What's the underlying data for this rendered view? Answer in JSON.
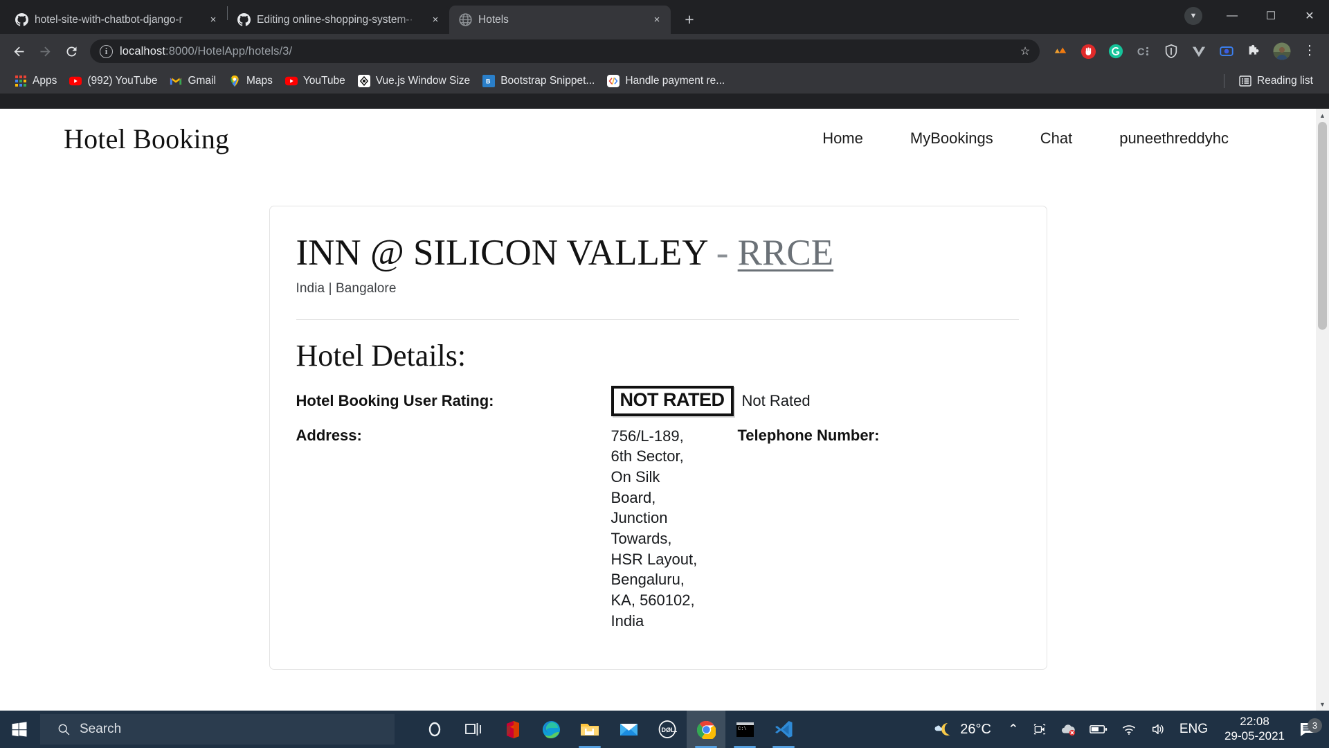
{
  "browser": {
    "tabs": [
      {
        "title": "hotel-site-with-chatbot-django-r",
        "icon": "github-icon",
        "active": false,
        "close_label": "×"
      },
      {
        "title": "Editing online-shopping-system-·",
        "icon": "github-icon",
        "active": false,
        "close_label": "×"
      },
      {
        "title": "Hotels",
        "icon": "globe-icon",
        "active": true,
        "close_label": "×"
      }
    ],
    "new_tab_label": "+",
    "window_controls": {
      "minimize": "—",
      "maximize": "☐",
      "close": "✕",
      "profile_chevron": "▼"
    },
    "nav": {
      "back": "←",
      "forward": "→",
      "reload": "↻"
    },
    "omnibox": {
      "url_host": "localhost",
      "url_path": ":8000/HotelApp/hotels/3/",
      "info_icon": "i",
      "star_icon": "☆"
    },
    "extensions": [
      "triangles-icon",
      "adblock-hand-icon",
      "grammarly-icon",
      "colorzilla-icon",
      "shield-icon",
      "vue-devtools-icon",
      "loom-icon",
      "puzzle-piece-icon",
      "profile-avatar",
      "three-dot-menu-icon"
    ],
    "bookmarks": [
      {
        "label": "Apps",
        "icon": "apps-grid-icon"
      },
      {
        "label": "(992) YouTube",
        "icon": "youtube-icon"
      },
      {
        "label": "Gmail",
        "icon": "gmail-icon"
      },
      {
        "label": "Maps",
        "icon": "maps-pin-icon"
      },
      {
        "label": "YouTube",
        "icon": "youtube-icon"
      },
      {
        "label": "Vue.js Window Size",
        "icon": "vuejs-icon"
      },
      {
        "label": "Bootstrap Snippet...",
        "icon": "bootstrap-icon"
      },
      {
        "label": "Handle payment re...",
        "icon": "codepen-icon"
      }
    ],
    "reading_list": {
      "label": "Reading list",
      "icon": "reading-list-icon"
    }
  },
  "site": {
    "brand": "Hotel Booking",
    "nav_links": [
      "Home",
      "MyBookings",
      "Chat",
      "puneethreddyhc"
    ]
  },
  "hotel": {
    "name": "INN @ SILICON VALLEY",
    "separator": "-",
    "college": "RRCE",
    "location": "India | Bangalore",
    "details_heading": "Hotel Details:",
    "rating": {
      "label": "Hotel Booking User Rating:",
      "badge_text": "NOT RATED",
      "value_text": "Not Rated"
    },
    "address": {
      "label": "Address:",
      "lines": [
        "756/L-189,",
        "6th Sector,",
        "On Silk",
        "Board,",
        "Junction",
        "Towards,",
        "HSR Layout,",
        "Bengaluru,",
        "KA, 560102,",
        "India"
      ]
    },
    "telephone": {
      "label": "Telephone Number:",
      "value": ""
    }
  },
  "taskbar": {
    "start_icon": "windows-logo-icon",
    "search_placeholder": "Search",
    "search_icon": "search-icon",
    "apps": [
      "cortana-icon",
      "task-view-icon",
      "office-icon",
      "edge-icon",
      "file-explorer-icon",
      "mail-icon",
      "dell-icon",
      "chrome-icon",
      "terminal-icon",
      "vscode-icon"
    ],
    "active_app": "chrome-icon",
    "tray": {
      "weather_icon": "moon-cloud-icon",
      "temperature": "26°C",
      "chevron_up": "⌃",
      "icons": [
        "camera-icon",
        "onedrive-offline-icon",
        "battery-icon",
        "wifi-icon",
        "volume-icon"
      ],
      "language": "ENG",
      "time": "22:08",
      "date": "29-05-2021",
      "notification_icon": "notification-icon",
      "notification_count": "3"
    }
  },
  "colors": {
    "chrome_dark": "#202124",
    "chrome_toolbar": "#35363a",
    "taskbar": "#1f3144",
    "accent_blue": "#56a0e0",
    "link_gray": "#6b7177"
  }
}
